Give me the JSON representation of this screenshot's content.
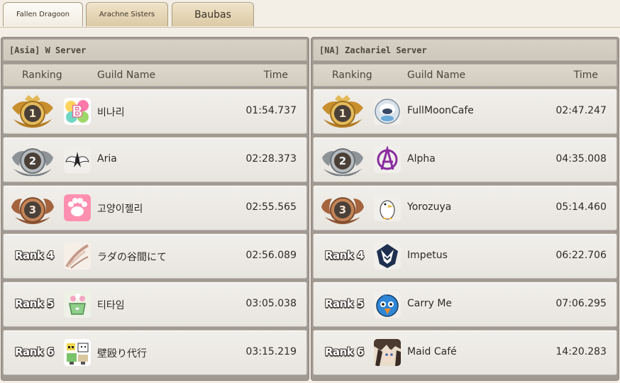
{
  "tabs": [
    {
      "label": "Fallen Dragoon",
      "active": true
    },
    {
      "label": "Arachne Sisters",
      "active": false
    },
    {
      "label": "Baubas",
      "active": false
    }
  ],
  "columns": {
    "ranking": "Ranking",
    "guild": "Guild Name",
    "time": "Time"
  },
  "servers": [
    {
      "title": "[Asia] W Server",
      "rows": [
        {
          "medal_number": "1",
          "medal": "gold",
          "emblem_icon": "bubble-letter-b-icon",
          "guild": "비나리",
          "time": "01:54.737"
        },
        {
          "medal_number": "2",
          "medal": "silver",
          "emblem_icon": "white-wing-icon",
          "guild": "Aria",
          "time": "02:28.373"
        },
        {
          "medal_number": "3",
          "medal": "bronze",
          "emblem_icon": "pink-paw-icon",
          "guild": "고양이젤리",
          "time": "02:55.565"
        },
        {
          "rank_label": "Rank 4",
          "emblem_icon": "feather-brush-icon",
          "guild": "ラダの谷間にて",
          "time": "02:56.089"
        },
        {
          "rank_label": "Rank 5",
          "emblem_icon": "flower-cup-icon",
          "guild": "티타임",
          "time": "03:05.038"
        },
        {
          "rank_label": "Rank 6",
          "emblem_icon": "pixel-character-icon",
          "guild": "壁殴り代行",
          "time": "03:15.219"
        }
      ]
    },
    {
      "title": "[NA] Zachariel Server",
      "rows": [
        {
          "medal_number": "1",
          "medal": "gold",
          "emblem_icon": "moon-creature-icon",
          "guild": "FullMoonCafe",
          "time": "02:47.247"
        },
        {
          "medal_number": "2",
          "medal": "silver",
          "emblem_icon": "purple-anarchy-icon",
          "guild": "Alpha",
          "time": "04:35.008"
        },
        {
          "medal_number": "3",
          "medal": "bronze",
          "emblem_icon": "penguin-icon",
          "guild": "Yorozuya",
          "time": "05:14.460"
        },
        {
          "rank_label": "Rank 4",
          "emblem_icon": "wolf-emblem-icon",
          "guild": "Impetus",
          "time": "06:22.706"
        },
        {
          "rank_label": "Rank 5",
          "emblem_icon": "blue-bird-icon",
          "guild": "Carry Me",
          "time": "07:06.295"
        },
        {
          "rank_label": "Rank 6",
          "emblem_icon": "maid-portrait-icon",
          "guild": "Maid Café",
          "time": "14:20.283"
        }
      ]
    }
  ],
  "colors": {
    "gold": "#d4a640",
    "silver": "#9aa0a5",
    "bronze": "#b2714a",
    "medal_center": "#4a4038"
  }
}
